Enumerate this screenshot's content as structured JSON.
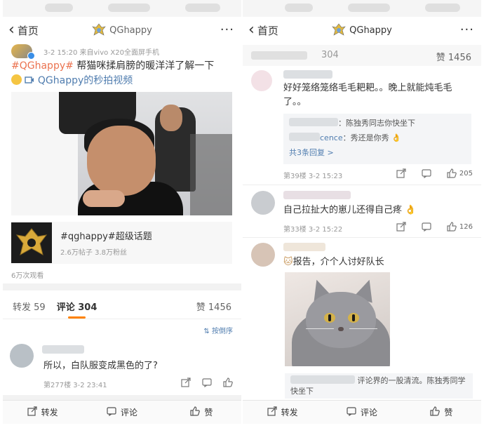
{
  "left": {
    "nav": {
      "back_label": "首页",
      "title": "QGhappy",
      "more": "···"
    },
    "post": {
      "meta": "3-2 15:20 来自vivo X20全面屏手机",
      "topic": "#QGhappy#",
      "text": " 帮猫咪揉肩膀的暖洋洋了解一下",
      "video_link": "QGhappy的秒拍视频"
    },
    "topic_card": {
      "name": "#qghappy#超级话题",
      "stats": "2.6万帖子 3.8万粉丝"
    },
    "views": "6万次观看",
    "tabs": {
      "repost_label": "转发",
      "repost_count": "59",
      "comment_label": "评论",
      "comment_count": "304",
      "like_label": "赞",
      "like_count": "1456"
    },
    "sort_label": "按倒序",
    "comment": {
      "text": "所以，白队服变成黑色的了?",
      "footer": "第277楼 3-2 23:41"
    },
    "bottom": {
      "repost": "转发",
      "comment": "评论",
      "like": "赞"
    }
  },
  "right": {
    "nav": {
      "back_label": "首页",
      "title": "QGhappy",
      "more": "···"
    },
    "tabs_partial": {
      "comment_count_partial": "304",
      "like_label": "赞",
      "like_count": "1456"
    },
    "comments": [
      {
        "text": "好好笼络笼络毛毛耙耙。。晚上就能炖毛毛了。。",
        "replies": [
          {
            "text": "：陈独秀同志你快坐下"
          },
          {
            "name": "cence",
            "text": "：秀还是你秀"
          }
        ],
        "more_replies": "共3条回复 >",
        "footer": "第39楼 3-2 15:23",
        "likes": "205"
      },
      {
        "text": "自己拉扯大的崽儿还得自己疼",
        "footer": "第33楼 3-2 15:22",
        "likes": "126"
      },
      {
        "text": "报告，介个人讨好队长",
        "reply": "评论界的一股清流。陈独秀同学快坐下"
      }
    ],
    "bottom": {
      "repost": "转发",
      "comment": "评论",
      "like": "赞"
    }
  },
  "colors": {
    "topic": "#eb7350",
    "link": "#507daf",
    "tab_underline": "#ff8200"
  },
  "icons": [
    "back-chevron-icon",
    "more-icon",
    "play-video-icon",
    "sort-icon",
    "share-icon",
    "comment-icon",
    "like-icon"
  ]
}
